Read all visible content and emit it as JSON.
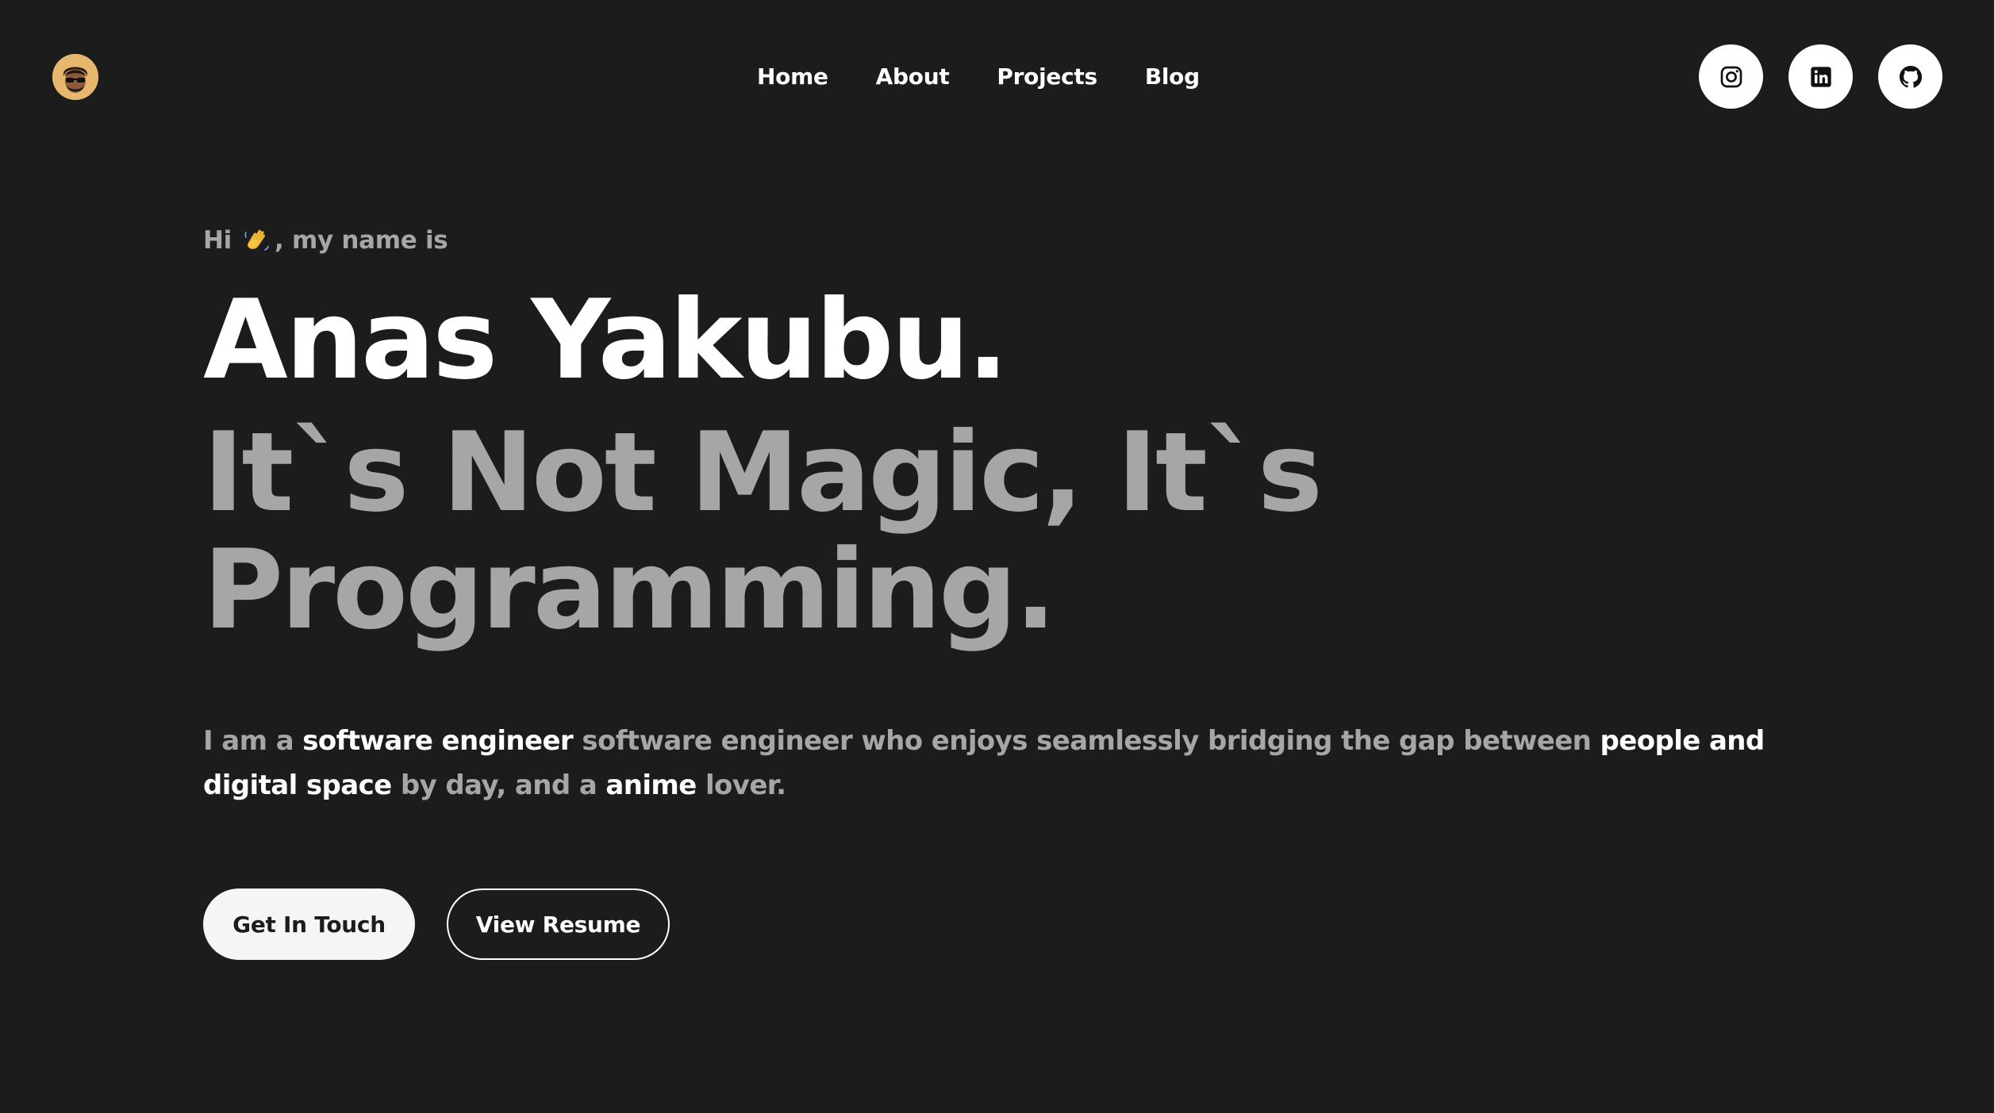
{
  "header": {
    "logo_alt": "avatar",
    "nav": [
      {
        "label": "Home"
      },
      {
        "label": "About"
      },
      {
        "label": "Projects"
      },
      {
        "label": "Blog"
      }
    ],
    "socials": [
      {
        "icon": "instagram-icon"
      },
      {
        "icon": "linkedin-icon"
      },
      {
        "icon": "github-icon"
      }
    ]
  },
  "hero": {
    "greeting_prefix": "Hi",
    "greeting_suffix": ", my name is",
    "name": "Anas Yakubu.",
    "tagline": "It`s Not Magic, It`s Programming.",
    "bio": {
      "p1": "I am a ",
      "h1": "software engineer",
      "p2": " software engineer who enjoys seamlessly bridging the gap between ",
      "h2": "people and digital space",
      "p3": " by day, and a ",
      "h3": "anime",
      "p4": " lover."
    },
    "buttons": {
      "primary": "Get In Touch",
      "secondary": "View Resume"
    }
  },
  "colors": {
    "background": "#1c1c1c",
    "text_primary": "#ffffff",
    "text_muted": "#a6a6a6",
    "avatar_bg": "#e7b76e"
  }
}
